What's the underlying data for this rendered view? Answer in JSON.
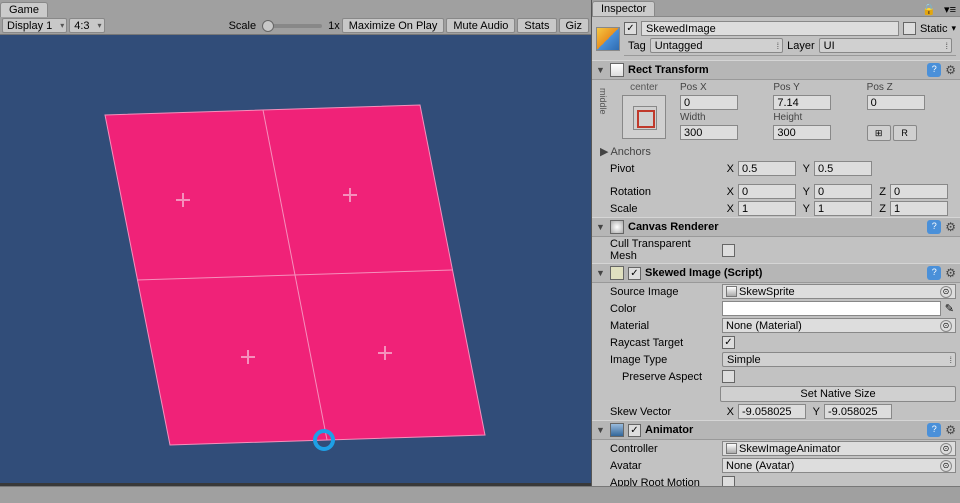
{
  "game": {
    "tab": "Game",
    "display": "Display 1",
    "aspect": "4:3",
    "scale_label": "Scale",
    "scale_value": "1x",
    "maximize": "Maximize On Play",
    "mute": "Mute Audio",
    "stats": "Stats",
    "gizmos": "Giz"
  },
  "inspector": {
    "tab": "Inspector",
    "name": "SkewedImage",
    "static": "Static",
    "tag_label": "Tag",
    "tag_value": "Untagged",
    "layer_label": "Layer",
    "layer_value": "UI"
  },
  "rect": {
    "title": "Rect Transform",
    "anchor_h": "center",
    "anchor_v": "middle",
    "posx_l": "Pos X",
    "posx": "0",
    "posy_l": "Pos Y",
    "posy": "7.14",
    "posz_l": "Pos Z",
    "posz": "0",
    "width_l": "Width",
    "width": "300",
    "height_l": "Height",
    "height": "300",
    "anchors": "Anchors",
    "pivot": "Pivot",
    "pivot_x": "0.5",
    "pivot_y": "0.5",
    "rotation": "Rotation",
    "rx": "0",
    "ry": "0",
    "rz": "0",
    "scale": "Scale",
    "sx": "1",
    "sy": "1",
    "sz": "1"
  },
  "canvas": {
    "title": "Canvas Renderer",
    "cull": "Cull Transparent Mesh"
  },
  "skewed": {
    "title": "Skewed Image (Script)",
    "source": "Source Image",
    "source_v": "SkewSprite",
    "color": "Color",
    "material": "Material",
    "material_v": "None (Material)",
    "raycast": "Raycast Target",
    "image_type": "Image Type",
    "image_type_v": "Simple",
    "preserve": "Preserve Aspect",
    "native": "Set Native Size",
    "skew": "Skew Vector",
    "skew_x": "-9.058025",
    "skew_y": "-9.058025"
  },
  "animator": {
    "title": "Animator",
    "controller": "Controller",
    "controller_v": "SkewImageAnimator",
    "avatar": "Avatar",
    "avatar_v": "None (Avatar)",
    "root": "Apply Root Motion"
  }
}
